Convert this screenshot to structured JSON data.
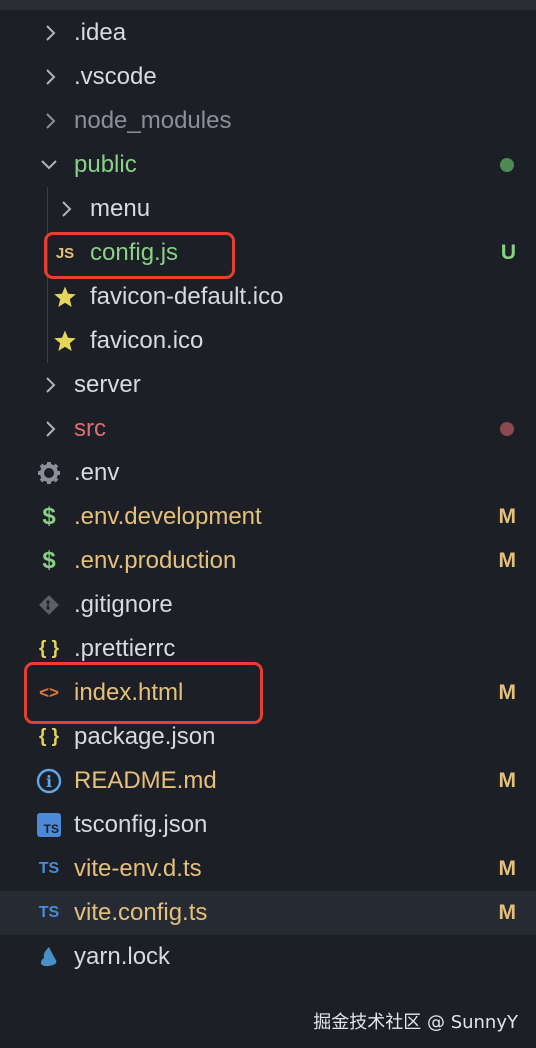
{
  "items": [
    {
      "label": ".idea",
      "icon": "chevron-right-icon",
      "status": ""
    },
    {
      "label": ".vscode",
      "icon": "chevron-right-icon",
      "status": ""
    },
    {
      "label": "node_modules",
      "icon": "chevron-right-icon",
      "status": ""
    },
    {
      "label": "public",
      "icon": "chevron-down-icon",
      "status": ""
    },
    {
      "label": "menu",
      "icon": "chevron-right-icon",
      "status": ""
    },
    {
      "label": "config.js",
      "icon": "js-file-icon",
      "icon_text": "JS",
      "status": "U"
    },
    {
      "label": "favicon-default.ico",
      "icon": "star-icon",
      "status": ""
    },
    {
      "label": "favicon.ico",
      "icon": "star-icon",
      "status": ""
    },
    {
      "label": "server",
      "icon": "chevron-right-icon",
      "status": ""
    },
    {
      "label": "src",
      "icon": "chevron-right-icon",
      "status": ""
    },
    {
      "label": ".env",
      "icon": "gear-icon",
      "status": ""
    },
    {
      "label": ".env.development",
      "icon": "dollar-icon",
      "icon_text": "$",
      "status": "M"
    },
    {
      "label": ".env.production",
      "icon": "dollar-icon",
      "icon_text": "$",
      "status": "M"
    },
    {
      "label": ".gitignore",
      "icon": "git-icon",
      "status": ""
    },
    {
      "label": ".prettierrc",
      "icon": "braces-icon",
      "icon_text": "{ }",
      "status": ""
    },
    {
      "label": "index.html",
      "icon": "html-icon",
      "icon_text": "<>",
      "status": "M"
    },
    {
      "label": "package.json",
      "icon": "braces-icon",
      "icon_text": "{ }",
      "status": ""
    },
    {
      "label": "README.md",
      "icon": "info-icon",
      "icon_text": "i",
      "status": "M"
    },
    {
      "label": "tsconfig.json",
      "icon": "ts-config-icon",
      "icon_text": "TS",
      "status": ""
    },
    {
      "label": "vite-env.d.ts",
      "icon": "ts-file-icon",
      "icon_text": "TS",
      "status": "M"
    },
    {
      "label": "vite.config.ts",
      "icon": "ts-file-icon",
      "icon_text": "TS",
      "status": "M"
    },
    {
      "label": "yarn.lock",
      "icon": "yarn-icon",
      "status": ""
    }
  ],
  "watermark": "掘金技术社区 @ SunnyY",
  "colors": {
    "background": "#1c1f26",
    "modified": "#e5c07b",
    "untracked": "#89d185",
    "error": "#e06c75",
    "highlight": "#e5402f"
  }
}
